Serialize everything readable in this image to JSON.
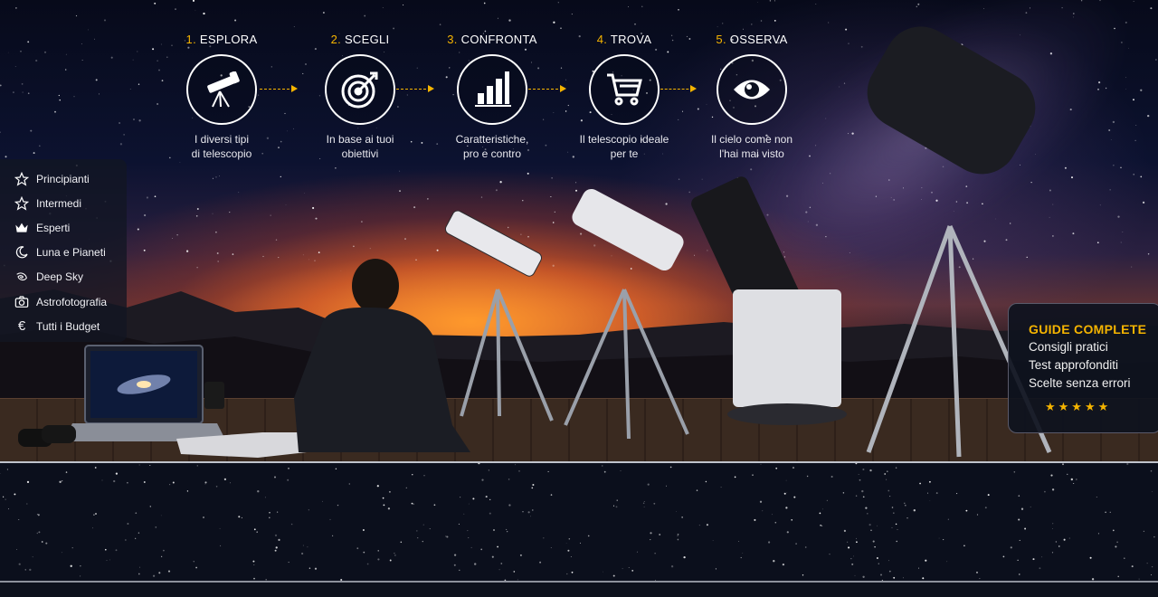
{
  "steps": [
    {
      "num": "1.",
      "title": "ESPLORA",
      "desc_line1": "I diversi tipi",
      "desc_line2": "di telescopio",
      "icon": "telescope-icon"
    },
    {
      "num": "2.",
      "title": "SCEGLI",
      "desc_line1": "In base ai tuoi",
      "desc_line2": "obiettivi",
      "icon": "target-icon"
    },
    {
      "num": "3.",
      "title": "CONFRONTA",
      "desc_line1": "Caratteristiche,",
      "desc_line2": "pro e contro",
      "icon": "bar-chart-icon"
    },
    {
      "num": "4.",
      "title": "TROVA",
      "desc_line1": "Il telescopio ideale",
      "desc_line2": "per te",
      "icon": "cart-icon"
    },
    {
      "num": "5.",
      "title": "OSSERVA",
      "desc_line1": "Il cielo come non",
      "desc_line2": "l'hai mai visto",
      "icon": "eye-icon"
    }
  ],
  "sidebar": {
    "items": [
      {
        "label": "Principianti",
        "icon": "star-outline-icon"
      },
      {
        "label": "Intermedi",
        "icon": "star-outline-icon"
      },
      {
        "label": "Esperti",
        "icon": "crown-icon"
      },
      {
        "label": "Luna e Pianeti",
        "icon": "moon-icon"
      },
      {
        "label": "Deep Sky",
        "icon": "galaxy-icon"
      },
      {
        "label": "Astrofotografia",
        "icon": "camera-icon"
      },
      {
        "label": "Tutti i Budget",
        "icon": "euro-icon"
      }
    ]
  },
  "guide": {
    "title": "GUIDE COMPLETE",
    "lines": [
      "Consigli pratici",
      "Test approfonditi",
      "Scelte senza errori"
    ],
    "stars": "★★★★★",
    "rating": 5
  },
  "colors": {
    "accent": "#f5b400",
    "panel": "#121622",
    "text": "#ffffff"
  }
}
